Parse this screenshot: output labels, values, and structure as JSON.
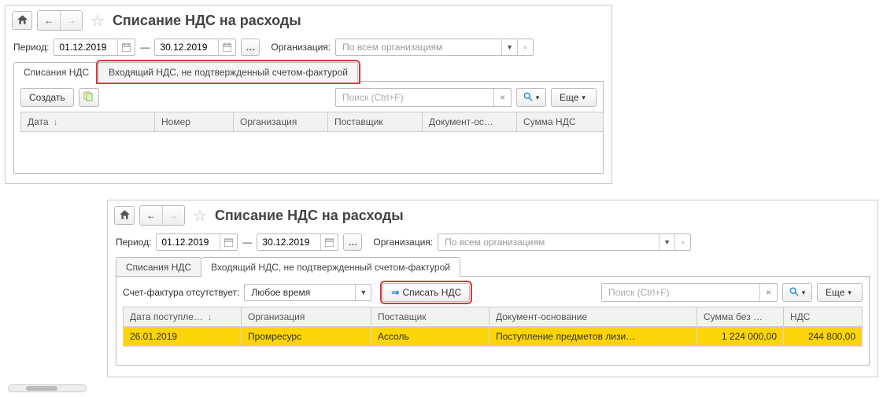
{
  "top": {
    "title": "Списание НДС на расходы",
    "period_label": "Период:",
    "date_from": "01.12.2019",
    "date_to": "30.12.2019",
    "date_sep": "—",
    "org_label": "Организация:",
    "org_placeholder": "По всем организациям",
    "tabs": {
      "spisania": "Списания НДС",
      "incoming": "Входящий НДС, не подтвержденный счетом-фактурой"
    },
    "toolbar": {
      "create": "Создать",
      "search_placeholder": "Поиск (Ctrl+F)",
      "more": "Еще"
    },
    "columns": {
      "date": "Дата",
      "number": "Номер",
      "org": "Организация",
      "supplier": "Поставщик",
      "docbase": "Документ-ос…",
      "vat": "Сумма НДС"
    }
  },
  "bottom": {
    "title": "Списание НДС на расходы",
    "period_label": "Период:",
    "date_from": "01.12.2019",
    "date_to": "30.12.2019",
    "date_sep": "—",
    "org_label": "Организация:",
    "org_placeholder": "По всем организациям",
    "tabs": {
      "spisania": "Списания НДС",
      "incoming": "Входящий НДС, не подтвержденный счетом-фактурой"
    },
    "filter2_label": "Счет-фактура отсутствует:",
    "filter2_value": "Любое время",
    "writeoff_btn": "Списать НДС",
    "search_placeholder": "Поиск (Ctrl+F)",
    "more": "Еще",
    "columns": {
      "date": "Дата поступле…",
      "org": "Организация",
      "supplier": "Поставщик",
      "docbase": "Документ-основание",
      "sum_no_vat": "Сумма без …",
      "vat": "НДС"
    },
    "row": {
      "date": "26.01.2019",
      "org": "Промресурс",
      "supplier": "Ассоль",
      "docbase": "Поступление предметов лизи…",
      "sum_no_vat": "1 224 000,00",
      "vat": "244 800,00"
    }
  }
}
